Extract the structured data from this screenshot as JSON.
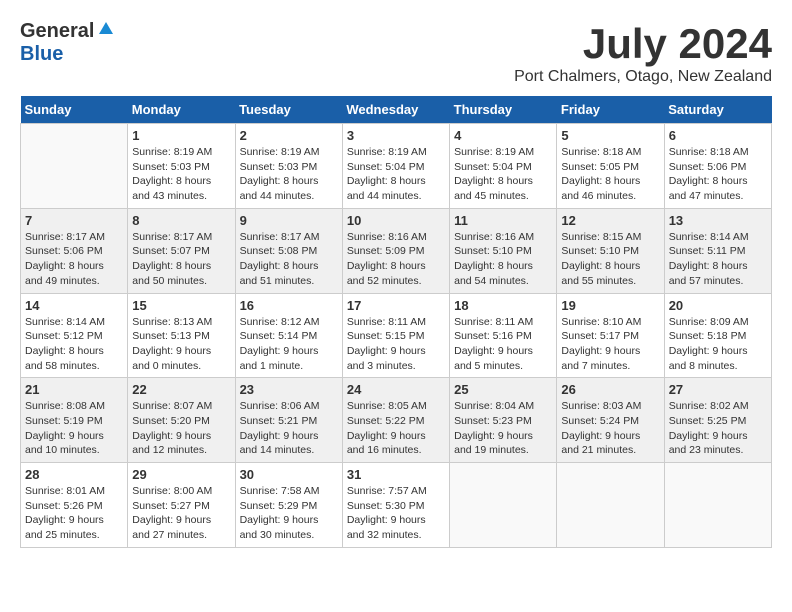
{
  "header": {
    "logo_general": "General",
    "logo_blue": "Blue",
    "month_title": "July 2024",
    "location": "Port Chalmers, Otago, New Zealand"
  },
  "weekdays": [
    "Sunday",
    "Monday",
    "Tuesday",
    "Wednesday",
    "Thursday",
    "Friday",
    "Saturday"
  ],
  "weeks": [
    [
      {
        "day": "",
        "sunrise": "",
        "sunset": "",
        "daylight": ""
      },
      {
        "day": "1",
        "sunrise": "Sunrise: 8:19 AM",
        "sunset": "Sunset: 5:03 PM",
        "daylight": "Daylight: 8 hours and 43 minutes."
      },
      {
        "day": "2",
        "sunrise": "Sunrise: 8:19 AM",
        "sunset": "Sunset: 5:03 PM",
        "daylight": "Daylight: 8 hours and 44 minutes."
      },
      {
        "day": "3",
        "sunrise": "Sunrise: 8:19 AM",
        "sunset": "Sunset: 5:04 PM",
        "daylight": "Daylight: 8 hours and 44 minutes."
      },
      {
        "day": "4",
        "sunrise": "Sunrise: 8:19 AM",
        "sunset": "Sunset: 5:04 PM",
        "daylight": "Daylight: 8 hours and 45 minutes."
      },
      {
        "day": "5",
        "sunrise": "Sunrise: 8:18 AM",
        "sunset": "Sunset: 5:05 PM",
        "daylight": "Daylight: 8 hours and 46 minutes."
      },
      {
        "day": "6",
        "sunrise": "Sunrise: 8:18 AM",
        "sunset": "Sunset: 5:06 PM",
        "daylight": "Daylight: 8 hours and 47 minutes."
      }
    ],
    [
      {
        "day": "7",
        "sunrise": "Sunrise: 8:17 AM",
        "sunset": "Sunset: 5:06 PM",
        "daylight": "Daylight: 8 hours and 49 minutes."
      },
      {
        "day": "8",
        "sunrise": "Sunrise: 8:17 AM",
        "sunset": "Sunset: 5:07 PM",
        "daylight": "Daylight: 8 hours and 50 minutes."
      },
      {
        "day": "9",
        "sunrise": "Sunrise: 8:17 AM",
        "sunset": "Sunset: 5:08 PM",
        "daylight": "Daylight: 8 hours and 51 minutes."
      },
      {
        "day": "10",
        "sunrise": "Sunrise: 8:16 AM",
        "sunset": "Sunset: 5:09 PM",
        "daylight": "Daylight: 8 hours and 52 minutes."
      },
      {
        "day": "11",
        "sunrise": "Sunrise: 8:16 AM",
        "sunset": "Sunset: 5:10 PM",
        "daylight": "Daylight: 8 hours and 54 minutes."
      },
      {
        "day": "12",
        "sunrise": "Sunrise: 8:15 AM",
        "sunset": "Sunset: 5:10 PM",
        "daylight": "Daylight: 8 hours and 55 minutes."
      },
      {
        "day": "13",
        "sunrise": "Sunrise: 8:14 AM",
        "sunset": "Sunset: 5:11 PM",
        "daylight": "Daylight: 8 hours and 57 minutes."
      }
    ],
    [
      {
        "day": "14",
        "sunrise": "Sunrise: 8:14 AM",
        "sunset": "Sunset: 5:12 PM",
        "daylight": "Daylight: 8 hours and 58 minutes."
      },
      {
        "day": "15",
        "sunrise": "Sunrise: 8:13 AM",
        "sunset": "Sunset: 5:13 PM",
        "daylight": "Daylight: 9 hours and 0 minutes."
      },
      {
        "day": "16",
        "sunrise": "Sunrise: 8:12 AM",
        "sunset": "Sunset: 5:14 PM",
        "daylight": "Daylight: 9 hours and 1 minute."
      },
      {
        "day": "17",
        "sunrise": "Sunrise: 8:11 AM",
        "sunset": "Sunset: 5:15 PM",
        "daylight": "Daylight: 9 hours and 3 minutes."
      },
      {
        "day": "18",
        "sunrise": "Sunrise: 8:11 AM",
        "sunset": "Sunset: 5:16 PM",
        "daylight": "Daylight: 9 hours and 5 minutes."
      },
      {
        "day": "19",
        "sunrise": "Sunrise: 8:10 AM",
        "sunset": "Sunset: 5:17 PM",
        "daylight": "Daylight: 9 hours and 7 minutes."
      },
      {
        "day": "20",
        "sunrise": "Sunrise: 8:09 AM",
        "sunset": "Sunset: 5:18 PM",
        "daylight": "Daylight: 9 hours and 8 minutes."
      }
    ],
    [
      {
        "day": "21",
        "sunrise": "Sunrise: 8:08 AM",
        "sunset": "Sunset: 5:19 PM",
        "daylight": "Daylight: 9 hours and 10 minutes."
      },
      {
        "day": "22",
        "sunrise": "Sunrise: 8:07 AM",
        "sunset": "Sunset: 5:20 PM",
        "daylight": "Daylight: 9 hours and 12 minutes."
      },
      {
        "day": "23",
        "sunrise": "Sunrise: 8:06 AM",
        "sunset": "Sunset: 5:21 PM",
        "daylight": "Daylight: 9 hours and 14 minutes."
      },
      {
        "day": "24",
        "sunrise": "Sunrise: 8:05 AM",
        "sunset": "Sunset: 5:22 PM",
        "daylight": "Daylight: 9 hours and 16 minutes."
      },
      {
        "day": "25",
        "sunrise": "Sunrise: 8:04 AM",
        "sunset": "Sunset: 5:23 PM",
        "daylight": "Daylight: 9 hours and 19 minutes."
      },
      {
        "day": "26",
        "sunrise": "Sunrise: 8:03 AM",
        "sunset": "Sunset: 5:24 PM",
        "daylight": "Daylight: 9 hours and 21 minutes."
      },
      {
        "day": "27",
        "sunrise": "Sunrise: 8:02 AM",
        "sunset": "Sunset: 5:25 PM",
        "daylight": "Daylight: 9 hours and 23 minutes."
      }
    ],
    [
      {
        "day": "28",
        "sunrise": "Sunrise: 8:01 AM",
        "sunset": "Sunset: 5:26 PM",
        "daylight": "Daylight: 9 hours and 25 minutes."
      },
      {
        "day": "29",
        "sunrise": "Sunrise: 8:00 AM",
        "sunset": "Sunset: 5:27 PM",
        "daylight": "Daylight: 9 hours and 27 minutes."
      },
      {
        "day": "30",
        "sunrise": "Sunrise: 7:58 AM",
        "sunset": "Sunset: 5:29 PM",
        "daylight": "Daylight: 9 hours and 30 minutes."
      },
      {
        "day": "31",
        "sunrise": "Sunrise: 7:57 AM",
        "sunset": "Sunset: 5:30 PM",
        "daylight": "Daylight: 9 hours and 32 minutes."
      },
      {
        "day": "",
        "sunrise": "",
        "sunset": "",
        "daylight": ""
      },
      {
        "day": "",
        "sunrise": "",
        "sunset": "",
        "daylight": ""
      },
      {
        "day": "",
        "sunrise": "",
        "sunset": "",
        "daylight": ""
      }
    ]
  ]
}
